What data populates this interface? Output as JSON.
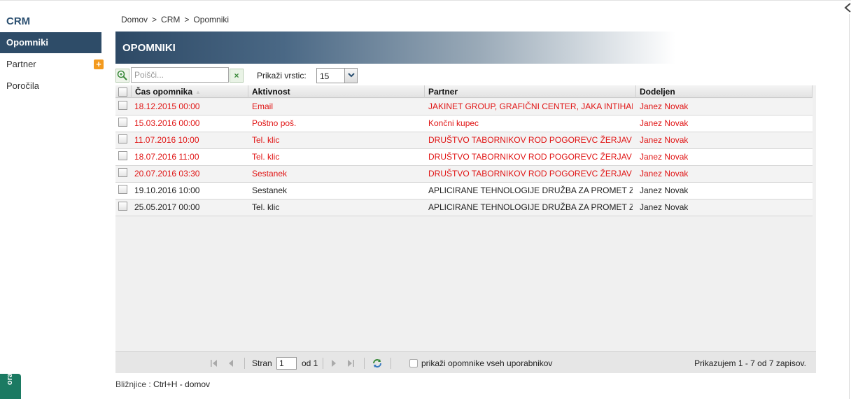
{
  "sidebar": {
    "title": "CRM",
    "items": [
      {
        "label": "Opomniki",
        "active": true
      },
      {
        "label": "Partner",
        "active": false
      },
      {
        "label": "Poročila",
        "active": false
      }
    ],
    "add_icon": "plus-icon",
    "badge_text": "ora"
  },
  "breadcrumb": {
    "items": [
      "Domov",
      "CRM",
      "Opomniki"
    ],
    "separator": ">"
  },
  "header": {
    "title": "OPOMNIKI"
  },
  "toolbar": {
    "search_placeholder": "Poišči...",
    "search_value": "",
    "rows_label": "Prikaži vrstic:",
    "rows_value": "15"
  },
  "table": {
    "columns": [
      "Čas opomnika",
      "Aktivnost",
      "Partner",
      "Dodeljen"
    ],
    "rows": [
      {
        "time": "18.12.2015 00:00",
        "activity": "Email",
        "partner": "JAKINET GROUP, GRAFIČNI CENTER, JAKA INTIHAR, ...",
        "assigned": "Janez Novak",
        "overdue": true
      },
      {
        "time": "15.03.2016 00:00",
        "activity": "Poštno poš.",
        "partner": "Končni kupec",
        "assigned": "Janez Novak",
        "overdue": true
      },
      {
        "time": "11.07.2016 10:00",
        "activity": "Tel. klic",
        "partner": "DRUŠTVO TABORNIKOV ROD POGOREVC ŽERJAV",
        "assigned": "Janez Novak",
        "overdue": true
      },
      {
        "time": "18.07.2016 11:00",
        "activity": "Tel. klic",
        "partner": "DRUŠTVO TABORNIKOV ROD POGOREVC ŽERJAV",
        "assigned": "Janez Novak",
        "overdue": true
      },
      {
        "time": "20.07.2016 03:30",
        "activity": "Sestanek",
        "partner": "DRUŠTVO TABORNIKOV ROD POGOREVC ŽERJAV",
        "assigned": "Janez Novak",
        "overdue": true
      },
      {
        "time": "19.10.2016 10:00",
        "activity": "Sestanek",
        "partner": "APLICIRANE TEHNOLOGIJE DRUŽBA ZA PROMET Z I...",
        "assigned": "Janez Novak",
        "overdue": false
      },
      {
        "time": "25.05.2017 00:00",
        "activity": "Tel. klic",
        "partner": "APLICIRANE TEHNOLOGIJE DRUŽBA ZA PROMET Z I...",
        "assigned": "Janez Novak",
        "overdue": false
      }
    ]
  },
  "pager": {
    "page_label": "Stran",
    "page_value": "1",
    "of_label": "od 1",
    "show_all_label": "prikaži opomnike vseh uporabnikov",
    "summary": "Prikazujem 1 - 7 od 7 zapisov."
  },
  "footer": {
    "shortcuts_label": "Bližnjice :",
    "shortcuts_value": "Ctrl+H - domov"
  },
  "colors": {
    "sidebar_active": "#2e4c68",
    "overdue_text": "#e01414",
    "add_icon": "#f39a1e",
    "badge": "#1b7a62"
  }
}
